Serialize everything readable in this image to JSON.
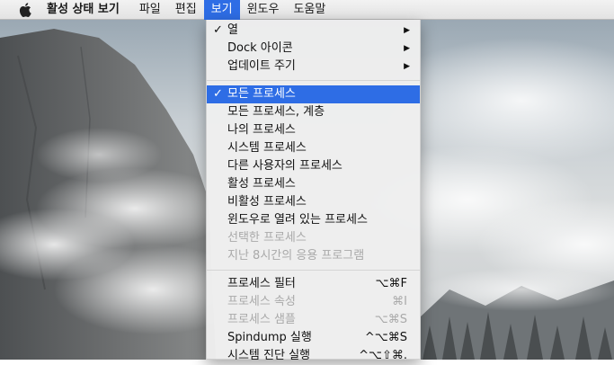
{
  "menubar": {
    "app_name": "활성 상태 보기",
    "items": [
      "파일",
      "편집",
      "보기",
      "윈도우",
      "도움말"
    ],
    "active_index": 2
  },
  "menu": {
    "items": [
      {
        "label": "열",
        "checked": true,
        "submenu": true
      },
      {
        "label": "Dock 아이콘",
        "submenu": true
      },
      {
        "label": "업데이트 주기",
        "submenu": true
      },
      {
        "label": "모든 프로세스",
        "checked": true,
        "selected": true
      },
      {
        "label": "모든 프로세스, 계층"
      },
      {
        "label": "나의 프로세스"
      },
      {
        "label": "시스템 프로세스"
      },
      {
        "label": "다른 사용자의 프로세스"
      },
      {
        "label": "활성 프로세스"
      },
      {
        "label": "비활성 프로세스"
      },
      {
        "label": "윈도우로 열려 있는 프로세스"
      },
      {
        "label": "선택한 프로세스",
        "disabled": true
      },
      {
        "label": "지난 8시간의 응용 프로그램",
        "disabled": true
      },
      {
        "label": "프로세스 필터",
        "shortcut": "⌥⌘F"
      },
      {
        "label": "프로세스 속성",
        "shortcut": "⌘I",
        "disabled": true
      },
      {
        "label": "프로세스 샘플",
        "shortcut": "⌥⌘S",
        "disabled": true
      },
      {
        "label": "Spindump 실행",
        "shortcut": "^⌥⌘S"
      },
      {
        "label": "시스템 진단 실행",
        "shortcut": "^⌥⇧⌘."
      }
    ]
  },
  "colors": {
    "highlight": "#2e6de5",
    "menu_bg": "#eeeeee",
    "disabled_text": "#a9a9a9"
  },
  "icons": {
    "apple": "apple-icon",
    "check": "checkmark-icon",
    "submenu": "triangle-right-icon"
  }
}
